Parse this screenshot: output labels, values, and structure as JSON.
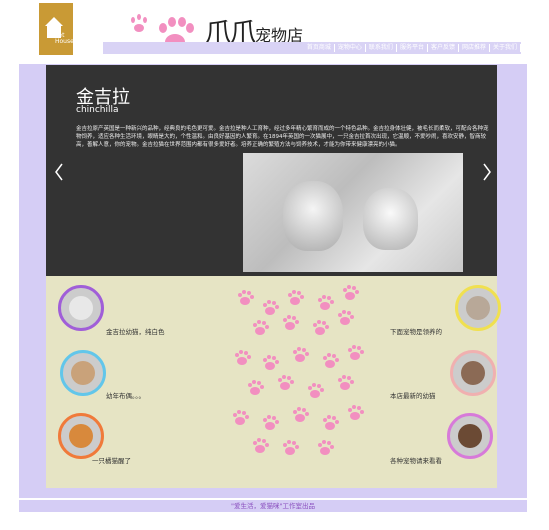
{
  "brand": {
    "logo_text": "Pet House",
    "name_big": "爪爪",
    "name_small": "宠物店"
  },
  "nav": {
    "items": [
      "首页商城",
      "宠物中心",
      "联系我们",
      "服务平台",
      "客户反馈",
      "网店推荐",
      "关于我们"
    ]
  },
  "banner": {
    "title": "金吉拉",
    "subtitle": "chinchilla",
    "description": "金吉拉原产英国是一种新兴的品种，经典良的毛色更可爱。金吉拉是种人工育种，经过多年精心繁育而成的一个特色品种。金吉拉身体壮健，被毛长而柔软，可配合各种宠物饲养，适应各种生活环境，眼睛是大的，个性温和。由良好基因的人繁育。在1894年英国的一次猫展中，一只金吉拉首次出现，它温顺，不爱吵闹，喜欢安静，智商较高，善解人意，你的宠物。金吉拉猫在世界范围内都有很多爱好者。培养正确的繁殖方法与饲养技术，才能为你带来健康漂亮的小猫。"
  },
  "gallery": {
    "left": [
      {
        "caption": "金吉拉幼猫，纯白色",
        "ring": "#a05ed8"
      },
      {
        "caption": "幼年布偶。。。",
        "ring": "#62c6ea"
      },
      {
        "caption": "一只橘猫醒了",
        "ring": "#f07a3a"
      }
    ],
    "right": [
      {
        "caption": "下面宠物是领养的",
        "ring": "#f0e050"
      },
      {
        "caption": "本店最新的幼猫",
        "ring": "#f0b0b0"
      },
      {
        "caption": "各种宠物请来看看",
        "ring": "#d77ad9"
      }
    ]
  },
  "footer": {
    "text": "\"爱生活，爱猫咪\"工作室出品"
  },
  "colors": {
    "frame": "#d5cdf5",
    "banner": "#333333",
    "content": "#e6e4c4",
    "paw": "#f28fc0"
  }
}
